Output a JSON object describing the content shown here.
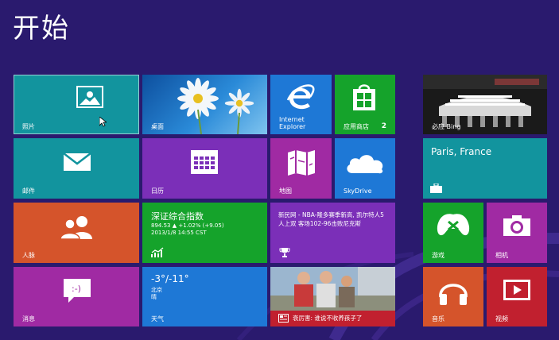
{
  "screen": {
    "title": "开始"
  },
  "colors": {
    "background": "#2a1a6e",
    "teal": "#12949e",
    "blue": "#1e78d6",
    "green": "#15a32b",
    "purple": "#7b2fb8",
    "orange": "#d5542b",
    "magenta": "#a02aa3"
  },
  "tiles": {
    "photos": {
      "label": "照片",
      "icon": "photo-icon"
    },
    "desktop": {
      "label": "桌面"
    },
    "ie": {
      "label": "Internet Explorer",
      "icon": "internet-explorer-icon"
    },
    "store": {
      "label": "应用商店",
      "badge": "2",
      "icon": "store-icon"
    },
    "bing": {
      "label": "必应 Bing"
    },
    "mail": {
      "label": "邮件",
      "icon": "mail-icon"
    },
    "calendar": {
      "label": "日历",
      "icon": "calendar-icon"
    },
    "maps": {
      "label": "地图",
      "icon": "map-icon"
    },
    "skydrive": {
      "label": "SkyDrive",
      "icon": "cloud-icon"
    },
    "weather_paris": {
      "city": "Paris, France",
      "icon": "suitcase-icon"
    },
    "people": {
      "label": "人脉",
      "icon": "people-icon"
    },
    "finance": {
      "title": "深证综合指数",
      "value_line": "894.53 ▲ +1.02% (+9.05)",
      "time_line": "2013/1/8 14:55 CST",
      "icon": "chart-up-icon"
    },
    "sports": {
      "headline": "新民网 - NBA-隆多赛季新高, 凯尔特人5人上双 客场102-96击败尼克斯",
      "icon": "trophy-icon"
    },
    "games": {
      "label": "游戏",
      "icon": "xbox-controller-icon"
    },
    "camera": {
      "label": "相机",
      "icon": "camera-icon"
    },
    "messaging": {
      "label": "消息",
      "icon": "chat-icon"
    },
    "weather": {
      "temp": "-3°/-11°",
      "city": "北京",
      "cond": "晴",
      "label": "天气"
    },
    "news": {
      "caption": "衰厉害: 谁说不收养孩子了",
      "icon": "news-icon"
    },
    "music": {
      "label": "音乐",
      "icon": "headphones-icon"
    },
    "video": {
      "label": "视频",
      "icon": "play-icon"
    }
  }
}
